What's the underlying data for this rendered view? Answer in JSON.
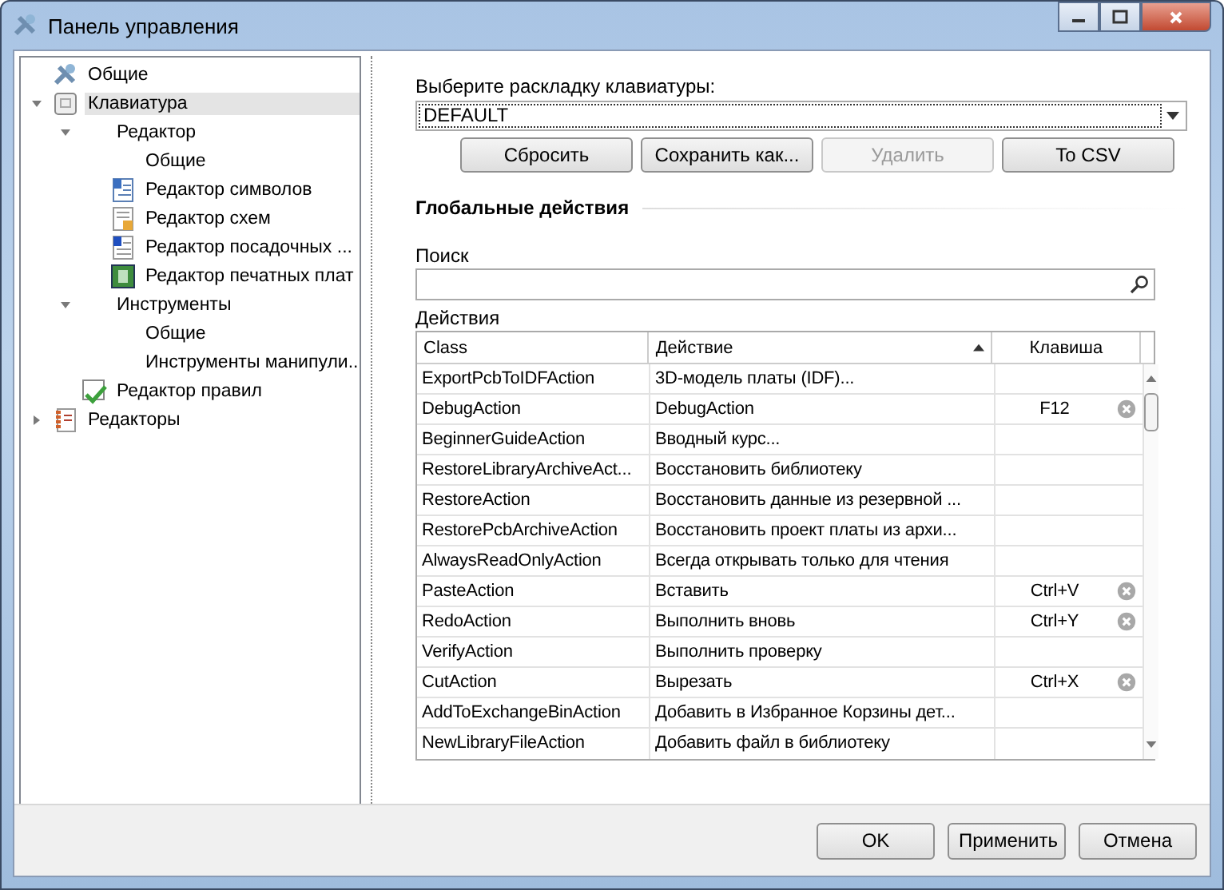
{
  "window": {
    "title": "Панель управления"
  },
  "tree": [
    {
      "label": "Общие",
      "kind": "tools",
      "selected": false
    },
    {
      "label": "Клавиатура",
      "kind": "keyboard",
      "selected": true,
      "expanded": true,
      "children": [
        {
          "label": "Редактор",
          "selected": false,
          "expanded": true,
          "children": [
            {
              "label": "Общие",
              "selected": false
            },
            {
              "label": "Редактор символов",
              "kind": "symbol",
              "selected": false
            },
            {
              "label": "Редактор схем",
              "kind": "schematic",
              "selected": false
            },
            {
              "label": "Редактор посадочных ...",
              "kind": "footprint",
              "selected": false
            },
            {
              "label": "Редактор печатных плат",
              "kind": "pcb",
              "selected": false
            }
          ]
        },
        {
          "label": "Инструменты",
          "selected": false,
          "expanded": true,
          "children": [
            {
              "label": "Общие",
              "selected": false
            },
            {
              "label": "Инструменты манипули...",
              "selected": false
            }
          ]
        },
        {
          "label": "Редактор правил",
          "kind": "rules",
          "selected": false
        }
      ]
    },
    {
      "label": "Редакторы",
      "kind": "editors",
      "selected": false,
      "expanded": false
    }
  ],
  "layout": {
    "label": "Выберите раскладку клавиатуры:",
    "value": "DEFAULT"
  },
  "layout_buttons": [
    {
      "label": "Сбросить",
      "disabled": false
    },
    {
      "label": "Сохранить как...",
      "disabled": false
    },
    {
      "label": "Удалить",
      "disabled": true
    },
    {
      "label": "To CSV",
      "disabled": false
    }
  ],
  "section_title": "Глобальные действия",
  "search": {
    "label": "Поиск"
  },
  "table": {
    "label": "Действия",
    "columns": [
      {
        "label": "Class",
        "sorted": false
      },
      {
        "label": "Действие",
        "sorted": true
      },
      {
        "label": "Клавиша",
        "sorted": false
      }
    ],
    "rows": [
      {
        "class": "ExportPcbToIDFAction",
        "action": "3D-модель платы (IDF)..."
      },
      {
        "class": "DebugAction",
        "action": "DebugAction",
        "key": "F12"
      },
      {
        "class": "BeginnerGuideAction",
        "action": "Вводный курс..."
      },
      {
        "class": "RestoreLibraryArchiveAct...",
        "action": "Восстановить библиотеку"
      },
      {
        "class": "RestoreAction",
        "action": "Восстановить данные из резервной ..."
      },
      {
        "class": "RestorePcbArchiveAction",
        "action": "Восстановить проект платы из архи..."
      },
      {
        "class": "AlwaysReadOnlyAction",
        "action": "Всегда открывать только для чтения"
      },
      {
        "class": "PasteAction",
        "action": "Вставить",
        "key": "Ctrl+V"
      },
      {
        "class": "RedoAction",
        "action": "Выполнить вновь",
        "key": "Ctrl+Y"
      },
      {
        "class": "VerifyAction",
        "action": "Выполнить проверку"
      },
      {
        "class": "CutAction",
        "action": "Вырезать",
        "key": "Ctrl+X"
      },
      {
        "class": "AddToExchangeBinAction",
        "action": "Добавить в Избранное Корзины дет..."
      },
      {
        "class": "NewLibraryFileAction",
        "action": "Добавить файл в библиотеку"
      }
    ]
  },
  "buttons": [
    "OK",
    "Применить",
    "Отмена"
  ]
}
